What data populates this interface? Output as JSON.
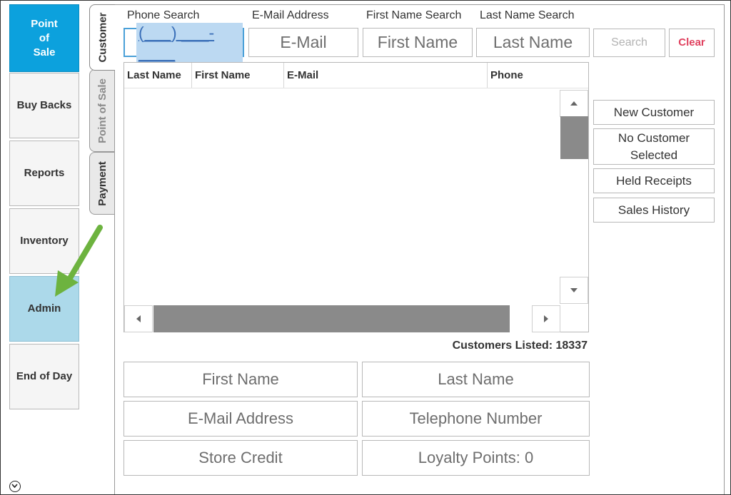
{
  "nav": {
    "items": [
      {
        "label": "Point\nof\nSale",
        "state": "active"
      },
      {
        "label": "Buy Backs",
        "state": "normal"
      },
      {
        "label": "Reports",
        "state": "normal"
      },
      {
        "label": "Inventory",
        "state": "normal"
      },
      {
        "label": "Admin",
        "state": "highlight"
      },
      {
        "label": "End of Day",
        "state": "normal"
      }
    ],
    "expand_icon": "chevron-down-circle-icon"
  },
  "tabs": [
    {
      "label": "Customer",
      "selected": true
    },
    {
      "label": "Point of Sale",
      "selected": false
    },
    {
      "label": "Payment",
      "selected": false
    }
  ],
  "search": {
    "phone_label": "Phone Search",
    "email_label": "E-Mail Address",
    "first_name_label": "First Name Search",
    "last_name_label": "Last Name Search",
    "phone_value": "(___) ___-____",
    "email_placeholder": "E-Mail",
    "first_name_placeholder": "First Name",
    "last_name_placeholder": "Last Name",
    "search_button": "Search",
    "clear_button": "Clear"
  },
  "grid": {
    "columns": [
      "Last Name",
      "First Name",
      "E-Mail",
      "Phone"
    ],
    "rows": []
  },
  "side_buttons": {
    "new_customer": "New Customer",
    "no_customer": "No Customer\nSelected",
    "held_receipts": "Held Receipts",
    "sales_history": "Sales History"
  },
  "customers_listed": "Customers Listed: 18337",
  "details": {
    "first_name": "First Name",
    "last_name": "Last Name",
    "email": "E-Mail Address",
    "telephone": "Telephone Number",
    "store_credit": "Store Credit",
    "loyalty_points": "Loyalty Points:  0"
  },
  "colors": {
    "active_nav": "#0ca1dd",
    "highlight_nav": "#acd9ea",
    "clear_text": "#e0405e",
    "annotation_arrow": "#6db33f"
  }
}
